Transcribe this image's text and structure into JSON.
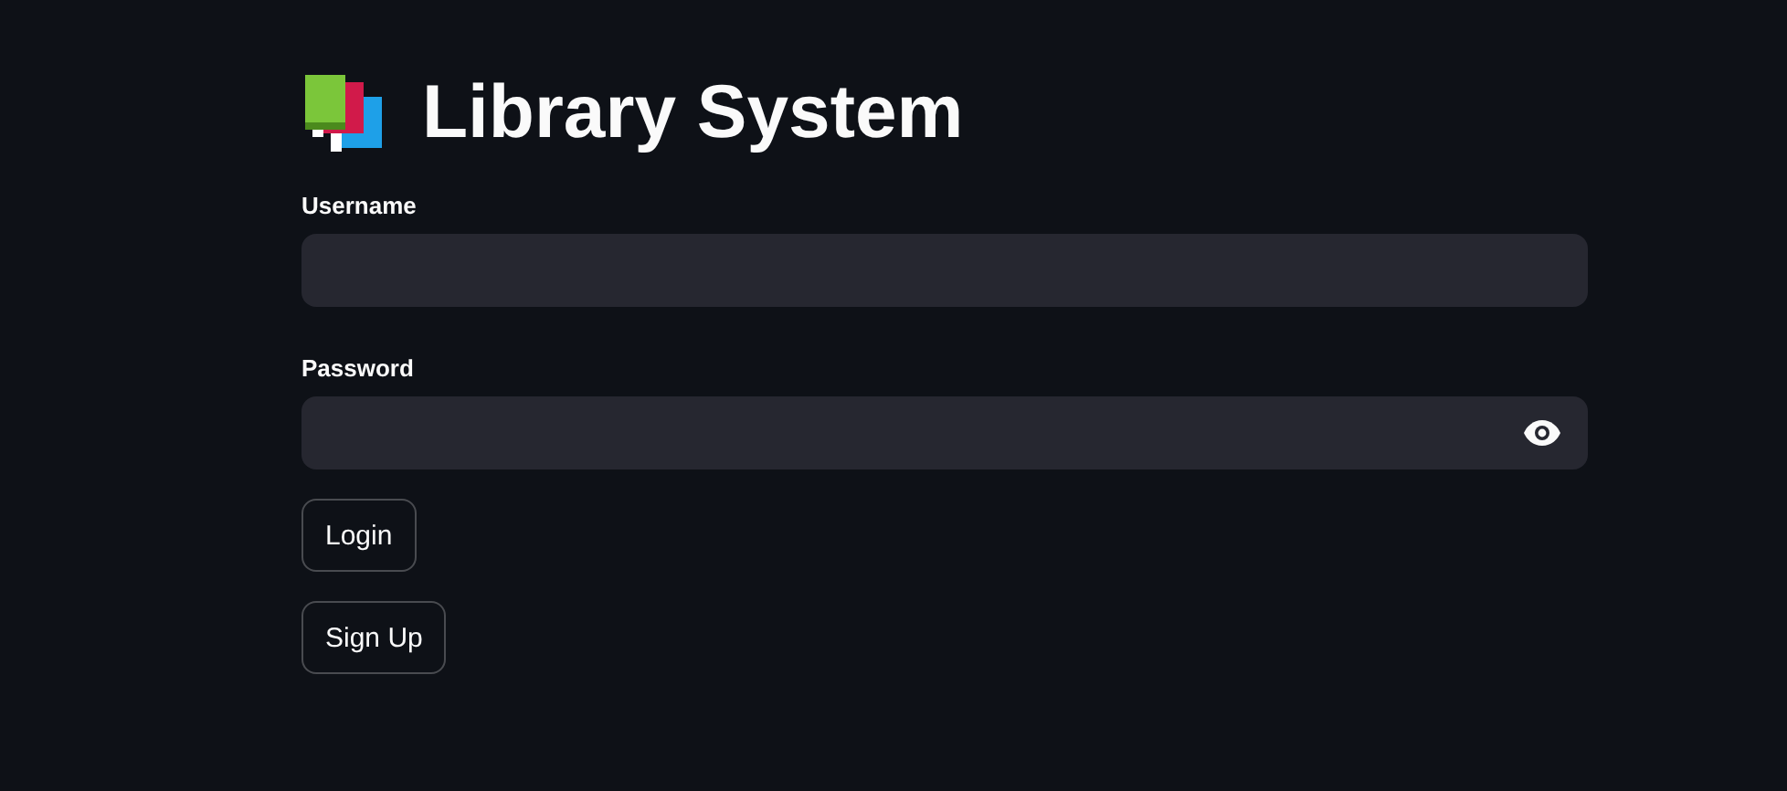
{
  "title": "Library System",
  "fields": [
    {
      "label": "Username",
      "kind": "text"
    },
    {
      "label": "Password",
      "kind": "password"
    }
  ],
  "buttons": [
    "Login",
    "Sign Up"
  ]
}
